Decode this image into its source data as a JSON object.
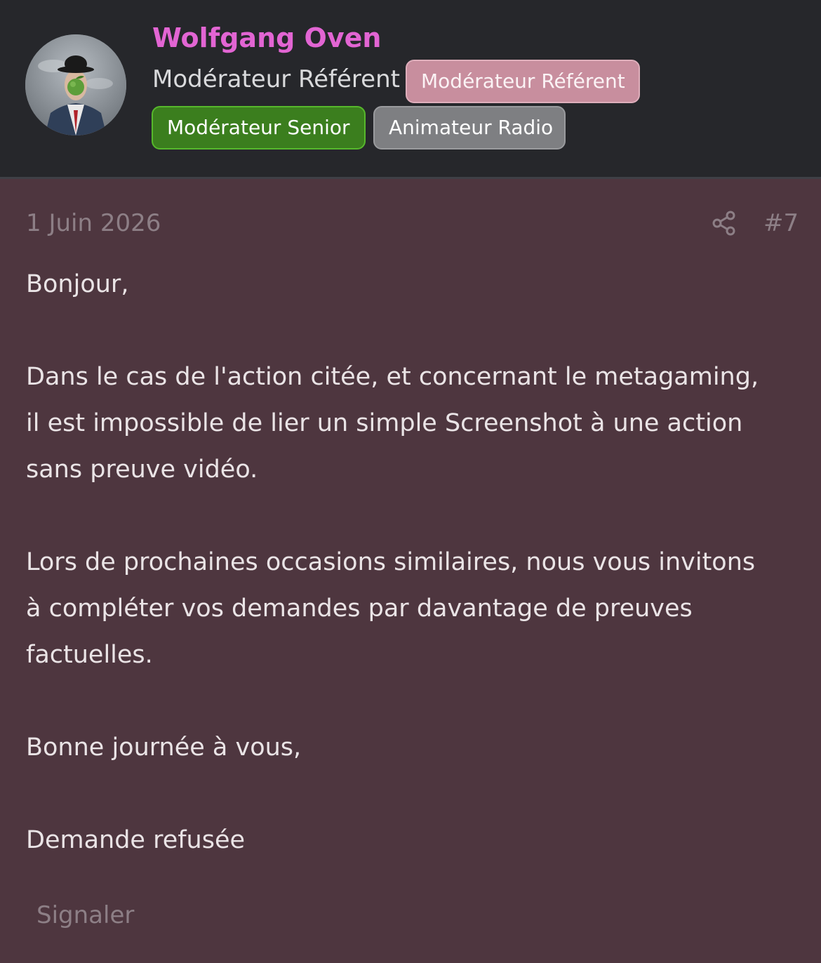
{
  "user": {
    "name": "Wolfgang Oven",
    "title": "Modérateur Référent",
    "name_color": "#e265d3",
    "avatar_icon": "bowler-hat-man-avatar",
    "badges": [
      {
        "label": "Modérateur Référent",
        "color": "#c88e9e"
      },
      {
        "label": "Modérateur Senior",
        "color": "#3b7e1e"
      },
      {
        "label": "Animateur Radio",
        "color": "#7e7f82"
      }
    ]
  },
  "post": {
    "date": "1 Juin 2026",
    "number": "#7",
    "share_icon": "share-icon",
    "body": {
      "greeting": "Bonjour,",
      "p1": [
        "Dans le cas de l'action citée, et concernant le metagaming,",
        "il est impossible de lier un simple Screenshot à une action",
        "sans preuve vidéo."
      ],
      "p2": [
        "Lors de prochaines occasions similaires, nous vous invitons",
        "à compléter vos demandes par davantage de preuves",
        "factuelles."
      ],
      "closing": "Bonne journée à vous,",
      "decision": "Demande refusée"
    },
    "report_label": "Signaler"
  },
  "colors": {
    "header_bg": "#26272b",
    "post_bg": "#4e363f",
    "muted_text": "#8d7f86",
    "body_text": "#eae4e6"
  }
}
